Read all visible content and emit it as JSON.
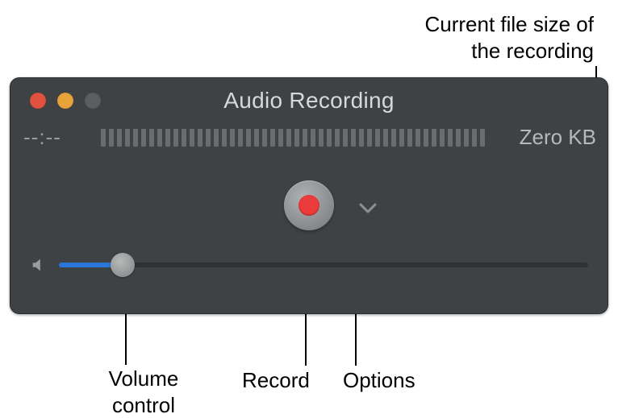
{
  "annotations": {
    "file_size": "Current file size of\nthe recording",
    "volume": "Volume\ncontrol",
    "record": "Record",
    "options": "Options"
  },
  "window": {
    "title": "Audio Recording",
    "elapsed_time": "--:--",
    "file_size": "Zero KB",
    "level_segments": 48,
    "volume_percent": 12
  }
}
